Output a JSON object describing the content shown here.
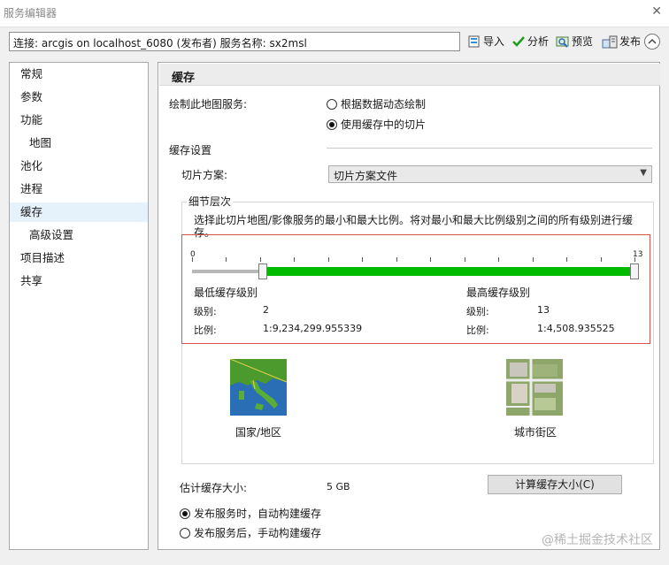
{
  "window": {
    "title": "服务编辑器"
  },
  "toolbar": {
    "connection": "连接: arcgis on localhost_6080 (发布者)    服务名称: sx2msl",
    "import_label": "导入",
    "analyze_label": "分析",
    "preview_label": "预览",
    "publish_label": "发布"
  },
  "sidebar": {
    "items": [
      {
        "label": "常规"
      },
      {
        "label": "参数"
      },
      {
        "label": "功能"
      },
      {
        "label": "地图"
      },
      {
        "label": "池化"
      },
      {
        "label": "进程"
      },
      {
        "label": "缓存"
      },
      {
        "label": "高级设置"
      },
      {
        "label": "项目描述"
      },
      {
        "label": "共享"
      }
    ]
  },
  "main": {
    "title": "缓存",
    "draw_label": "绘制此地图服务:",
    "radio_dynamic": "根据数据动态绘制",
    "radio_cache": "使用缓存中的切片",
    "cache_settings": "缓存设置",
    "tiling_label": "切片方案:",
    "tiling_value": "切片方案文件",
    "lod_title": "细节层次",
    "lod_desc": "选择此切片地图/影像服务的最小和最大比例。将对最小和最大比例级别之间的所有级别进行缓存。",
    "slider_min_label": "0",
    "slider_max_label": "13",
    "slider_low": 2,
    "slider_high": 13,
    "slider_max": 13,
    "min_cache_title": "最低缓存级别",
    "max_cache_title": "最高缓存级别",
    "level_label": "级别:",
    "scale_label": "比例:",
    "min_level": "2",
    "max_level": "13",
    "min_scale": "1:9,234,299.955339",
    "max_scale": "1:4,508.935525",
    "country_label": "国家/地区",
    "city_label": "城市街区",
    "estimate_label": "估计缓存大小:",
    "estimate_value": "5 GB",
    "calc_button": "计算缓存大小(C)",
    "auto_build": "发布服务时，自动构建缓存",
    "manual_build": "发布服务后，手动构建缓存"
  },
  "watermark": "@稀土掘金技术社区"
}
